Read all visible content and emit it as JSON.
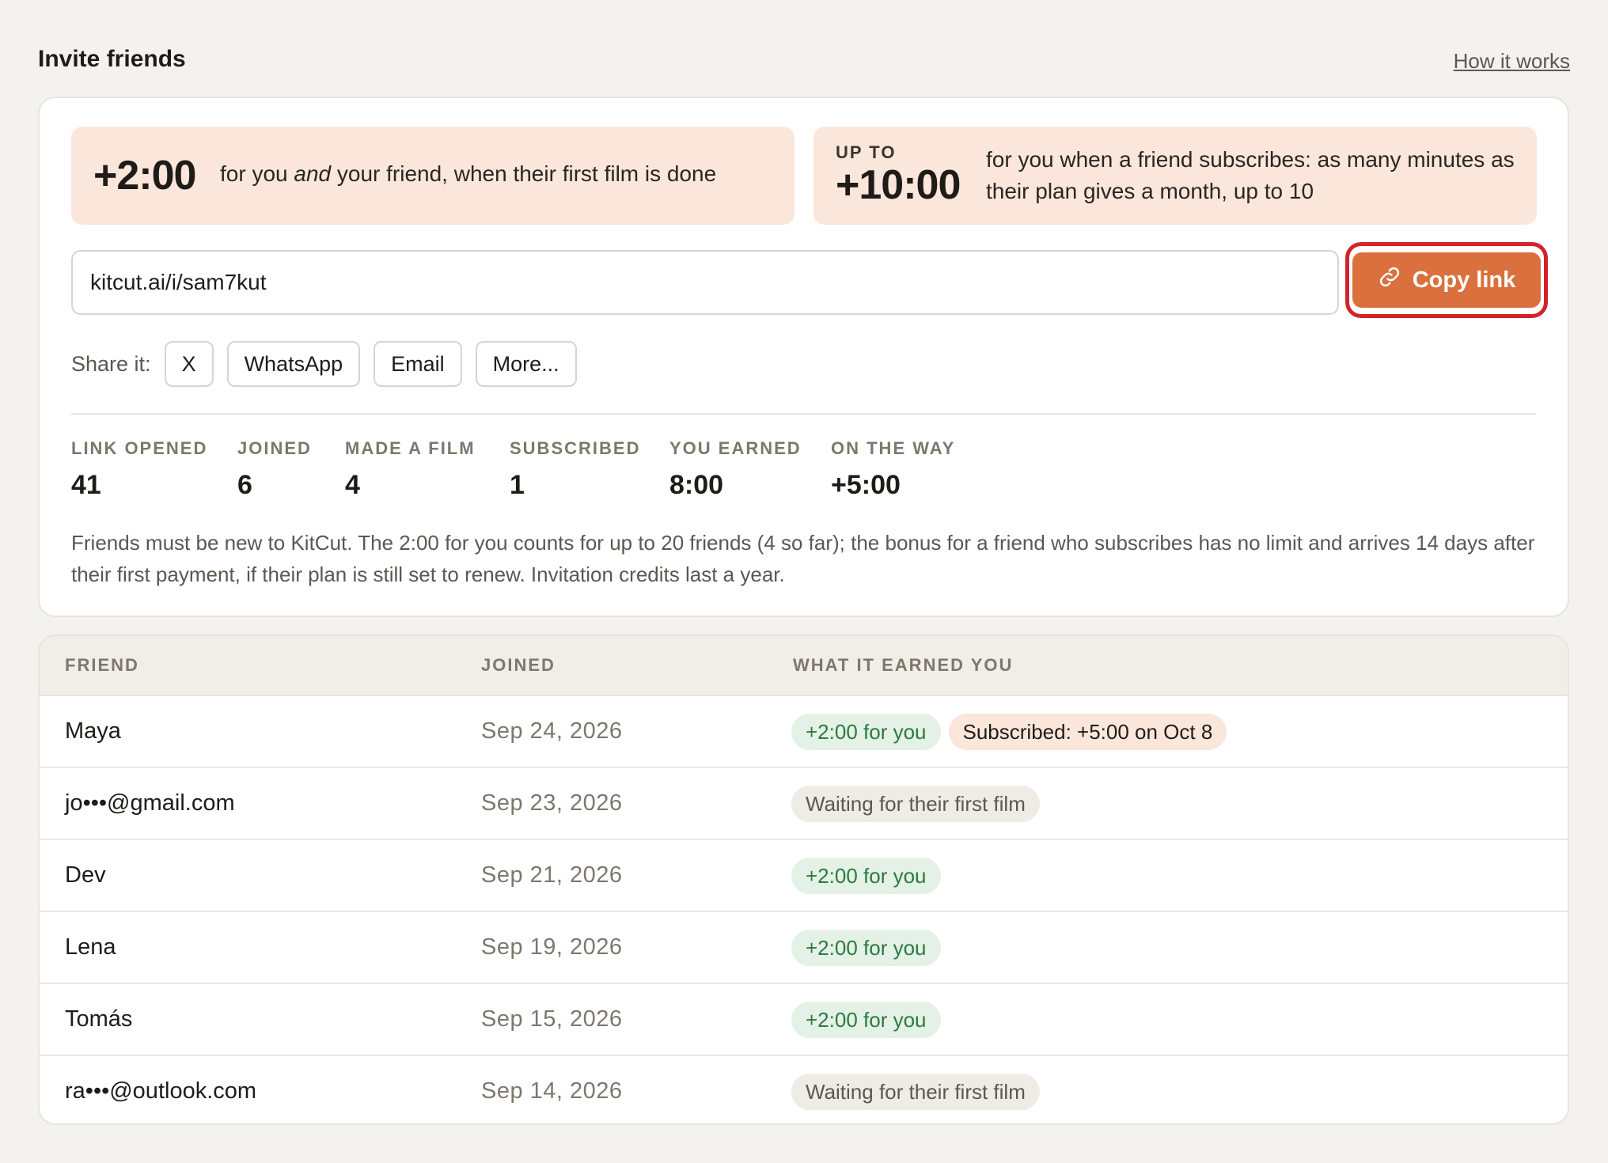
{
  "header": {
    "title": "Invite friends",
    "how_link": "How it works"
  },
  "rewards": {
    "first": {
      "amount": "+2:00",
      "text_before": "for you ",
      "text_em": "and",
      "text_after": " your friend, when their first film is done"
    },
    "second": {
      "prefix": "UP TO",
      "amount": "+10:00",
      "text": "for you when a friend subscribes: as many minutes as their plan gives a month, up to 10"
    }
  },
  "invite_link": {
    "value": "kitcut.ai/i/sam7kut",
    "copy_label": "Copy link",
    "copy_icon": "link-icon",
    "accent_color": "#d9703d",
    "highlight_color": "#d2232c"
  },
  "share": {
    "label": "Share it:",
    "options": [
      "X",
      "WhatsApp",
      "Email",
      "More..."
    ]
  },
  "stats": [
    {
      "label": "LINK OPENED",
      "value": "41"
    },
    {
      "label": "JOINED",
      "value": "6"
    },
    {
      "label": "MADE A FILM",
      "value": "4"
    },
    {
      "label": "SUBSCRIBED",
      "value": "1"
    },
    {
      "label": "YOU EARNED",
      "value": "8:00"
    },
    {
      "label": "ON THE WAY",
      "value": "+5:00"
    }
  ],
  "fineprint": "Friends must be new to KitCut. The 2:00 for you counts for up to 20 friends (4 so far); the bonus for a friend who subscribes has no limit and arrives 14 days after their first payment, if their plan is still set to renew. Invitation credits last a year.",
  "table": {
    "columns": [
      "FRIEND",
      "JOINED",
      "WHAT IT EARNED YOU"
    ],
    "rows": [
      {
        "name": "Maya",
        "joined": "Sep 24, 2026",
        "earned": [
          "+2:00 for you",
          "Subscribed: +5:00 on Oct 8"
        ]
      },
      {
        "name": "jo•••@gmail.com",
        "joined": "Sep 23, 2026",
        "earned": [
          "Waiting for their first film"
        ]
      },
      {
        "name": "Dev",
        "joined": "Sep 21, 2026",
        "earned": [
          "+2:00 for you"
        ]
      },
      {
        "name": "Lena",
        "joined": "Sep 19, 2026",
        "earned": [
          "+2:00 for you"
        ]
      },
      {
        "name": "Tomás",
        "joined": "Sep 15, 2026",
        "earned": [
          "+2:00 for you"
        ]
      },
      {
        "name": "ra•••@outlook.com",
        "joined": "Sep 14, 2026",
        "earned": [
          "Waiting for their first film"
        ]
      }
    ]
  }
}
